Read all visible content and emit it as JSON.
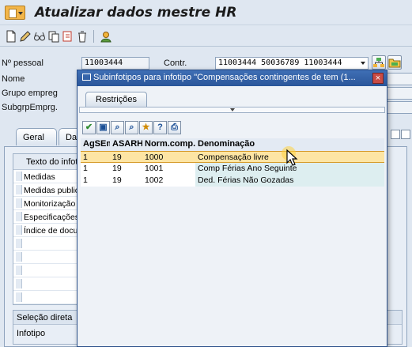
{
  "window": {
    "title": "Atualizar dados mestre HR"
  },
  "header": {
    "personnel_no_label": "Nº pessoal",
    "personnel_no_value": "11003444",
    "contract_label": "Contr.",
    "contract_value": "11003444 50036789 11003444",
    "name_label": "Nome",
    "employee_group_label": "Grupo empreg",
    "employee_subgroup_label": "SubgrpEmprg."
  },
  "tabs": [
    {
      "label": "Geral"
    },
    {
      "label": "Dad"
    }
  ],
  "infotype_table": {
    "header": "Texto do infot",
    "rows": [
      "Medidas",
      "Medidas public",
      "Monitorização d",
      "Especificações",
      "Índice de docu"
    ]
  },
  "direct_selection": {
    "title": "Seleção direta",
    "infotype_label": "Infotipo"
  },
  "dialog": {
    "title": "Subinfotipos para infotipo \"Compensações contingentes de tem (1...",
    "close_label": "×",
    "tab_label": "Restrições",
    "columns": [
      "AgSEm",
      "ASARH",
      "Norm.comp.",
      "Denominação"
    ],
    "rows": [
      {
        "agsem": "1",
        "asarh": "19",
        "norm": "1000",
        "denom": "Compensação livre",
        "selected": true
      },
      {
        "agsem": "1",
        "asarh": "19",
        "norm": "1001",
        "denom": "Comp Férias Ano Seguinte",
        "selected": false
      },
      {
        "agsem": "1",
        "asarh": "19",
        "norm": "1002",
        "denom": "Ded. Férias Não Gozadas",
        "selected": false
      }
    ]
  },
  "colors": {
    "titlebar_blue": "#2a569a",
    "selection": "#fde5a4",
    "background": "#dfe7f1"
  }
}
